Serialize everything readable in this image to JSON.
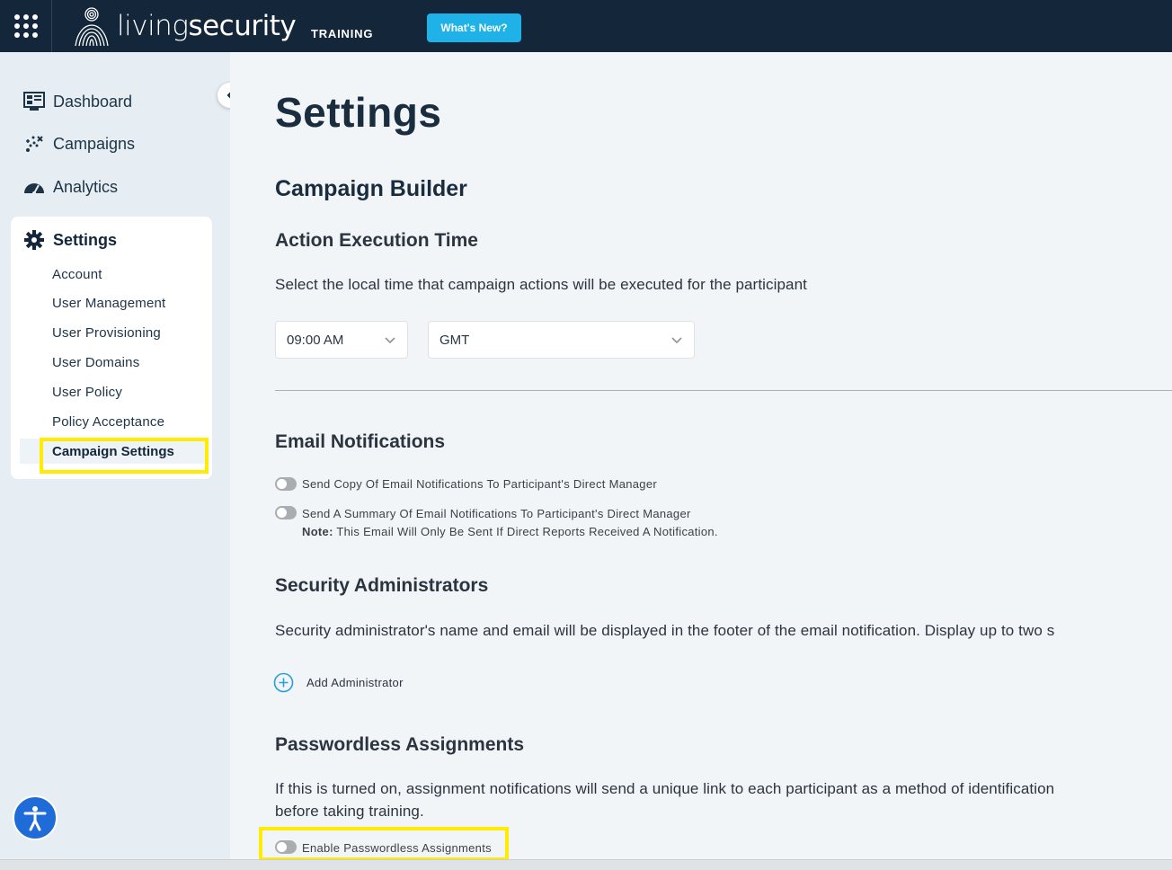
{
  "header": {
    "brand_light": "living",
    "brand_bold": "security",
    "product": "TRAINING",
    "whats_new": "What's New?"
  },
  "sidebar": {
    "items": [
      {
        "label": "Dashboard",
        "icon": "dashboard-icon"
      },
      {
        "label": "Campaigns",
        "icon": "campaigns-icon"
      },
      {
        "label": "Analytics",
        "icon": "analytics-icon"
      }
    ],
    "settings": {
      "label": "Settings",
      "icon": "gear-icon",
      "sub_items": [
        "Account",
        "User Management",
        "User Provisioning",
        "User Domains",
        "User Policy",
        "Policy Acceptance",
        "Campaign Settings"
      ],
      "active": "Campaign Settings"
    }
  },
  "main": {
    "title": "Settings",
    "campaign_builder": "Campaign Builder",
    "action_execution": {
      "heading": "Action Execution Time",
      "description": "Select the local time that campaign actions will be executed for the participant",
      "time_value": "09:00 AM",
      "timezone_value": "GMT"
    },
    "email_notifications": {
      "heading": "Email Notifications",
      "toggle1": "Send Copy Of Email Notifications To Participant's Direct Manager",
      "toggle2": "Send A Summary Of Email Notifications To Participant's Direct Manager",
      "note_label": "Note:",
      "note_text": " This Email Will Only Be Sent If Direct Reports Received A Notification."
    },
    "security_admins": {
      "heading": "Security Administrators",
      "description": "Security administrator's name and email will be displayed in the footer of the email notification. Display up to two s",
      "add_label": "Add Administrator"
    },
    "passwordless": {
      "heading": "Passwordless Assignments",
      "description_line1": "If this is turned on, assignment notifications will send a unique link to each participant as a method of identification",
      "description_line2": "before taking training.",
      "toggle_label": "Enable Passwordless Assignments"
    }
  },
  "colors": {
    "topbar": "#13263a",
    "accent": "#1fb2e8",
    "highlight": "#ffec00",
    "sidebar_bg": "#e6eef3"
  }
}
